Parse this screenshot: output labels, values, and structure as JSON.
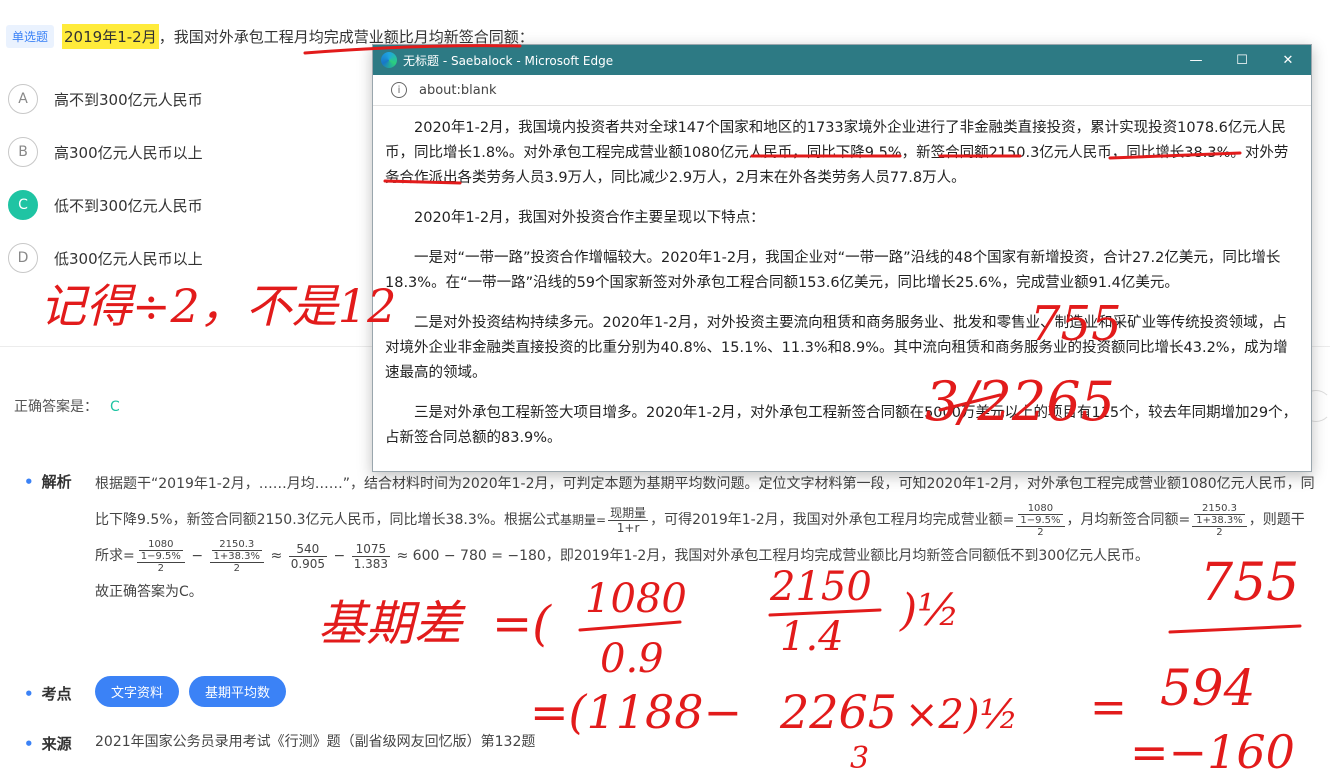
{
  "question": {
    "type_tag": "单选题",
    "highlight": "2019年1-2月",
    "text": "，我国对外承包工程月均完成营业额比月均新签合同额："
  },
  "options": [
    {
      "letter": "A",
      "text": "高不到300亿元人民币",
      "correct": false
    },
    {
      "letter": "B",
      "text": "高300亿元人民币以上",
      "correct": false
    },
    {
      "letter": "C",
      "text": "低不到300亿元人民币",
      "correct": true
    },
    {
      "letter": "D",
      "text": "低300亿元人民币以上",
      "correct": false
    }
  ],
  "answer": {
    "label": "正确答案是：",
    "value": "C"
  },
  "analysis": {
    "title": "解析",
    "part1": "根据题干“2019年1-2月，……月均……”，结合材料时间为2020年1-2月，可判定本题为基期平均数问题。定位文字材料第一段，可知2020年1-2月，对外承包工程完成营业额1080亿元人民币，同比下降9.5%，新签合同额2150.3亿元人民币，同比增长38.3%。根据公式",
    "formula_label": "基期量=",
    "f_base_num": "现期量",
    "f_base_den": "1+r",
    "part2": "，可得2019年1-2月，我国对外承包工程月均完成营业额=",
    "f_rev_num_top": "1080",
    "f_rev_num_bot": "1−9.5%",
    "f_den_2": "2",
    "part3": "，月均新签合同额=",
    "f_new_num_top": "2150.3",
    "f_new_num_bot": "1+38.3%",
    "part4": "，则题干所求=",
    "minus": " − ",
    "approx": " ≈ ",
    "f_540": "540",
    "f_0905": "0.905",
    "f_1075": "1075",
    "f_1383": "1.383",
    "calc_tail": " ≈ 600 − 780 = −180，即2019年1-2月，我国对外承包工程月均完成营业额比月均新签合同额低不到300亿元人民币。",
    "conclusion": "故正确答案为C。"
  },
  "points": {
    "title": "考点",
    "chips": [
      "文字资料",
      "基期平均数"
    ]
  },
  "source": {
    "title": "来源",
    "text": "2021年国家公务员录用考试《行测》题（副省级网友回忆版）第132题"
  },
  "browser": {
    "title": "无标题 - Saebalock - Microsoft Edge",
    "url": "about:blank",
    "minimize": "—",
    "maximize": "☐",
    "close": "✕",
    "paragraphs": [
      "2020年1-2月，我国境内投资者共对全球147个国家和地区的1733家境外企业进行了非金融类直接投资，累计实现投资1078.6亿元人民币，同比增长1.8%。对外承包工程完成营业额1080亿元人民币，同比下降9.5%，新签合同额2150.3亿元人民币，同比增长38.3%。对外劳务合作派出各类劳务人员3.9万人，同比减少2.9万人，2月末在外各类劳务人员77.8万人。",
      "2020年1-2月，我国对外投资合作主要呈现以下特点：",
      "一是对“一带一路”投资合作增幅较大。2020年1-2月，我国企业对“一带一路”沿线的48个国家有新增投资，合计27.2亿美元，同比增长18.3%。在“一带一路”沿线的59个国家新签对外承包工程合同额153.6亿美元，同比增长25.6%，完成营业额91.4亿美元。",
      "二是对外投资结构持续多元。2020年1-2月，对外投资主要流向租赁和商务服务业、批发和零售业、制造业和采矿业等传统投资领域，占对境外企业非金融类直接投资的比重分别为40.8%、15.1%、11.3%和8.9%。其中流向租赁和商务服务业的投资额同比增长43.2%，成为增速最高的领域。",
      "三是对外承包工程新签大项目增多。2020年1-2月，对外承包工程新签合同额在5000万美元以上的项目有115个，较去年同期增加29个，占新签合同总额的83.9%。"
    ]
  },
  "handwriting": {
    "note1": "记得÷2，不是12",
    "n755a": "755",
    "n3_2265": "3/2265",
    "base_label": "基期差",
    "eq1_a": "=(",
    "eq1_1080": "1080",
    "eq1_09": "0.9",
    "eq1_2150": "2150",
    "eq1_14": "1.4",
    "eq1_half": ")½",
    "n755b": "755",
    "eq2_open": "=(1188−",
    "eq2_2265": "2265",
    "eq2_3": "3",
    "eq2_x2": "×2)½",
    "eq2_eq": "=",
    "n594": "594",
    "eq3": "=−160",
    "ink_color": "#e21b1b"
  }
}
